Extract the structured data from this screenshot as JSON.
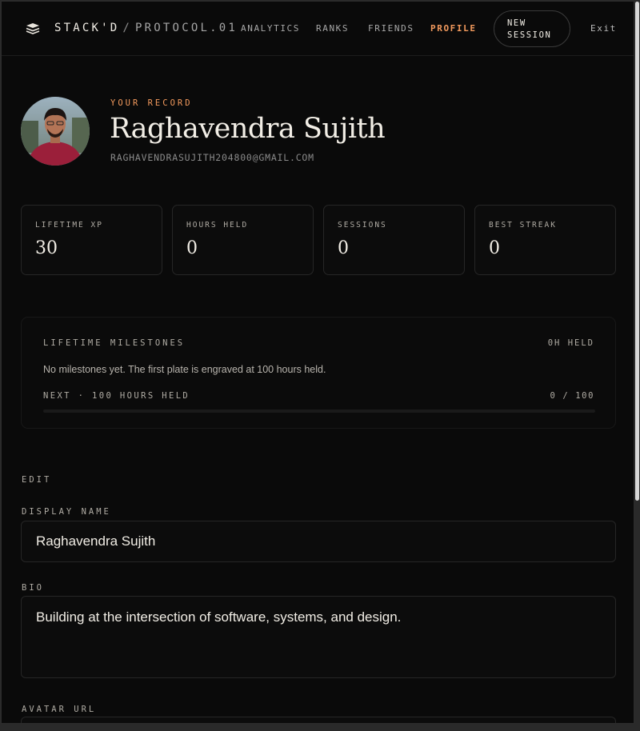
{
  "header": {
    "brand": "STACK'D",
    "separator": "/",
    "protocol": "PROTOCOL.01",
    "nav": [
      {
        "label": "ANALYTICS",
        "active": false
      },
      {
        "label": "RANKS",
        "active": false
      },
      {
        "label": "FRIENDS",
        "active": false
      },
      {
        "label": "PROFILE",
        "active": true
      }
    ],
    "new_session_line1": "NEW",
    "new_session_line2": "SESSION",
    "exit": "Exit"
  },
  "profile": {
    "record_label": "YOUR RECORD",
    "name": "Raghavendra Sujith",
    "email": "RAGHAVENDRASUJITH204800@GMAIL.COM"
  },
  "stats": [
    {
      "label": "LIFETIME XP",
      "value": "30"
    },
    {
      "label": "HOURS HELD",
      "value": "0"
    },
    {
      "label": "SESSIONS",
      "value": "0"
    },
    {
      "label": "BEST STREAK",
      "value": "0"
    }
  ],
  "milestones": {
    "title": "LIFETIME MILESTONES",
    "held": "0H HELD",
    "message": "No milestones yet. The first plate is engraved at 100 hours held.",
    "next_label": "NEXT · 100 HOURS HELD",
    "progress_text": "0 / 100",
    "progress_fraction": 0
  },
  "edit": {
    "section_label": "EDIT",
    "display_name_label": "DISPLAY NAME",
    "display_name_value": "Raghavendra Sujith",
    "bio_label": "BIO",
    "bio_value": "Building at the intersection of software, systems, and design.",
    "avatar_url_label": "AVATAR URL"
  },
  "colors": {
    "accent": "#f39a5d",
    "background": "#0a0a0a",
    "text": "#f2eee6"
  }
}
